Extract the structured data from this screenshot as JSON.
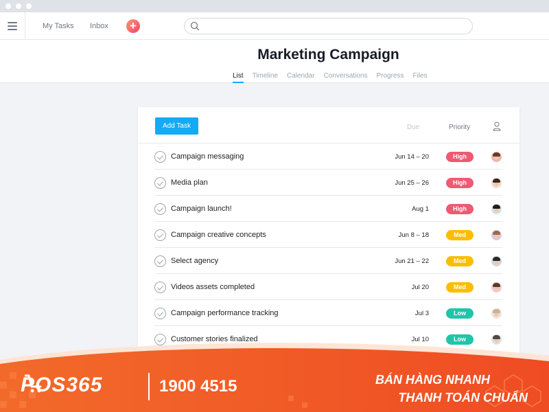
{
  "window": {
    "dots": 3
  },
  "topbar": {
    "nav": [
      "My Tasks",
      "Inbox"
    ],
    "search": {
      "placeholder": "",
      "value": ""
    },
    "plus_glyph": "+"
  },
  "project": {
    "title": "Marketing Campaign",
    "tabs": [
      "List",
      "Timeline",
      "Calendar",
      "Conversations",
      "Progress",
      "Files"
    ],
    "active_tab": "List"
  },
  "list": {
    "add_task_label": "Add Task",
    "columns": {
      "due": "Due",
      "priority": "Priority"
    },
    "rows": [
      {
        "name": "Campaign messaging",
        "due": "Jun 14 – 20",
        "priority": "High"
      },
      {
        "name": "Media plan",
        "due": "Jun 25 – 26",
        "priority": "High"
      },
      {
        "name": "Campaign launch!",
        "due": "Aug 1",
        "priority": "High"
      },
      {
        "name": "Campaign creative concepts",
        "due": "Jun 8 – 18",
        "priority": "Med"
      },
      {
        "name": "Select agency",
        "due": "Jun 21 – 22",
        "priority": "Med"
      },
      {
        "name": "Videos assets completed",
        "due": "Jul 20",
        "priority": "Med"
      },
      {
        "name": "Campaign performance tracking",
        "due": "Jul 3",
        "priority": "Low"
      },
      {
        "name": "Customer stories finalized",
        "due": "Jul 10",
        "priority": "Low"
      }
    ]
  },
  "priority_colors": {
    "High": "#ed5a72",
    "Med": "#fcbd01",
    "Low": "#1ec6a9"
  },
  "banner": {
    "logo": "POS365",
    "hotline": "1900 4515",
    "slogan_line1": "BÁN HÀNG NHANH",
    "slogan_line2": "THANH TOÁN CHUẨN",
    "color": "#f15a24"
  }
}
